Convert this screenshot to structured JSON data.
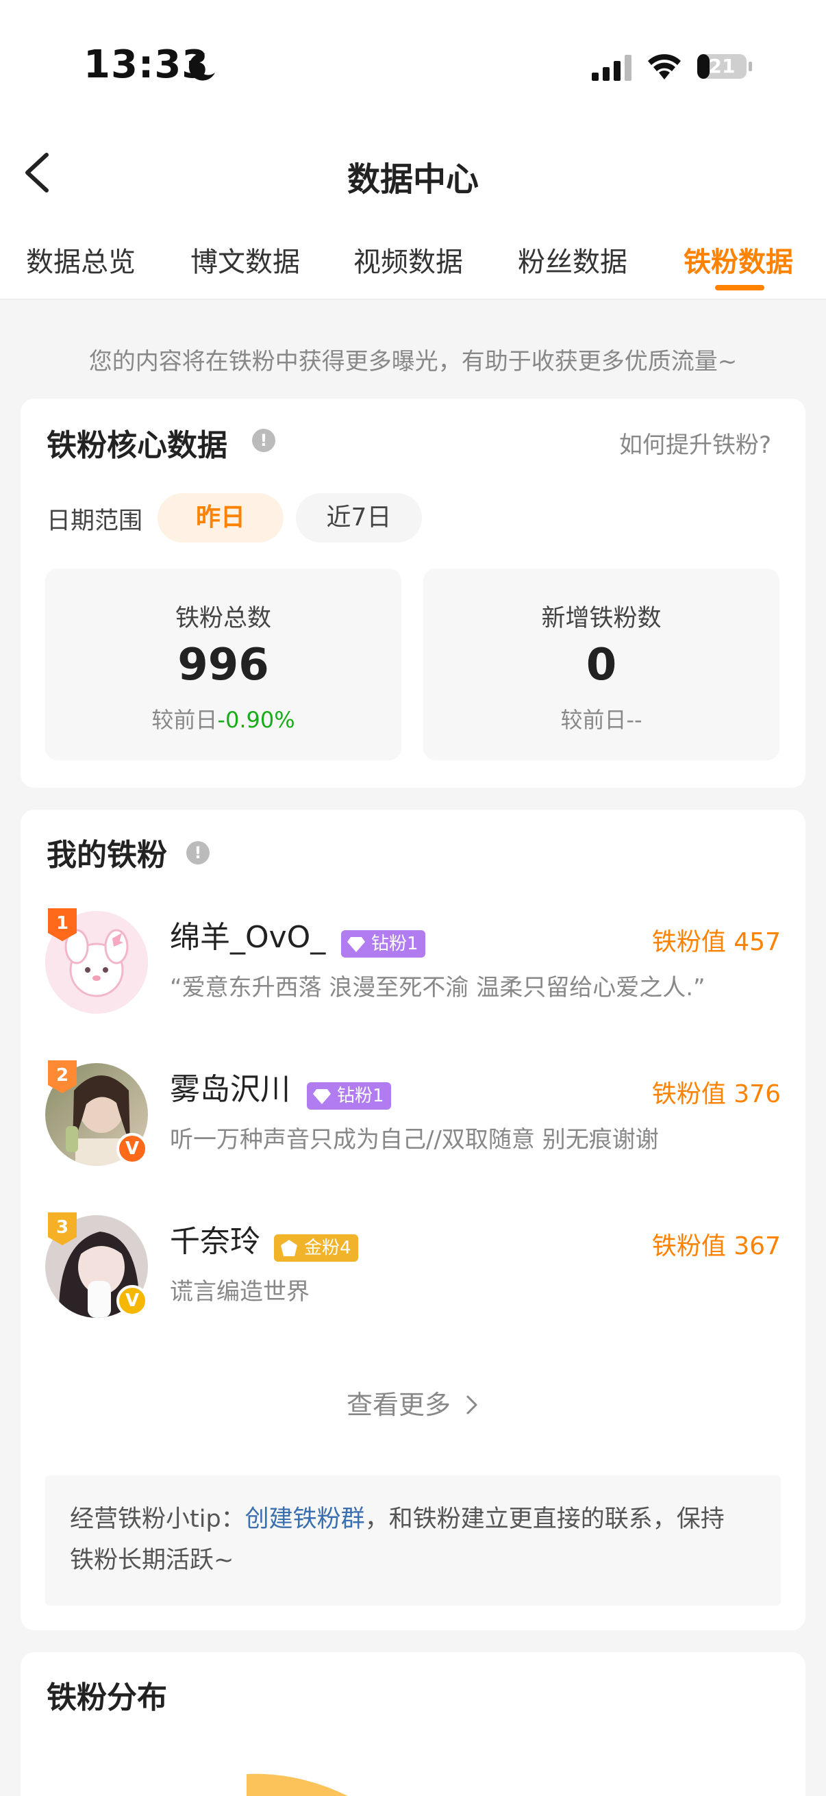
{
  "status_bar": {
    "time": "13:33",
    "battery": "21"
  },
  "header": {
    "title": "数据中心"
  },
  "tabs": [
    {
      "label": "数据总览"
    },
    {
      "label": "博文数据"
    },
    {
      "label": "视频数据"
    },
    {
      "label": "粉丝数据"
    },
    {
      "label": "铁粉数据",
      "active": true
    }
  ],
  "notice": "您的内容将在铁粉中获得更多曝光，有助于收获更多优质流量~",
  "core": {
    "title": "铁粉核心数据",
    "help_link": "如何提升铁粉?",
    "date_label": "日期范围",
    "date_options": [
      "昨日",
      "近7日"
    ],
    "selected_date": "昨日",
    "stats": [
      {
        "label": "铁粉总数",
        "value": "996",
        "delta_prefix": "较前日",
        "delta": "-0.90%"
      },
      {
        "label": "新增铁粉数",
        "value": "0",
        "delta_prefix": "较前日",
        "delta": "--"
      }
    ]
  },
  "my_fans": {
    "title": "我的铁粉",
    "items": [
      {
        "rank": "1",
        "name": "绵羊_OvO_",
        "tag": "钻粉1",
        "tag_type": "diamond",
        "score_label": "铁粉值",
        "score": "457",
        "bio": "“爱意东升西落 浪漫至死不渝 温柔只留给心爱之人.”",
        "verified": "none"
      },
      {
        "rank": "2",
        "name": "雾岛沢川",
        "tag": "钻粉1",
        "tag_type": "diamond",
        "score_label": "铁粉值",
        "score": "376",
        "bio": "听一万种声音只成为自己//双取随意 别无痕谢谢",
        "verified": "orange"
      },
      {
        "rank": "3",
        "name": "千奈玲",
        "tag": "金粉4",
        "tag_type": "gold",
        "score_label": "铁粉值",
        "score": "367",
        "bio": "谎言编造世界",
        "verified": "yellow"
      }
    ],
    "see_more": "查看更多",
    "tip_prefix": "经营铁粉小tip：",
    "tip_link": "创建铁粉群",
    "tip_suffix_1": "，和铁粉建立更直接的联系，保持",
    "tip_suffix_2": "铁粉长期活跃~"
  },
  "distribution": {
    "title": "铁粉分布"
  },
  "colors": {
    "accent": "#ff8200",
    "green": "#1aad19",
    "link": "#3a6fb0",
    "diamond": "#b07cf0",
    "gold": "#f0b32a"
  }
}
